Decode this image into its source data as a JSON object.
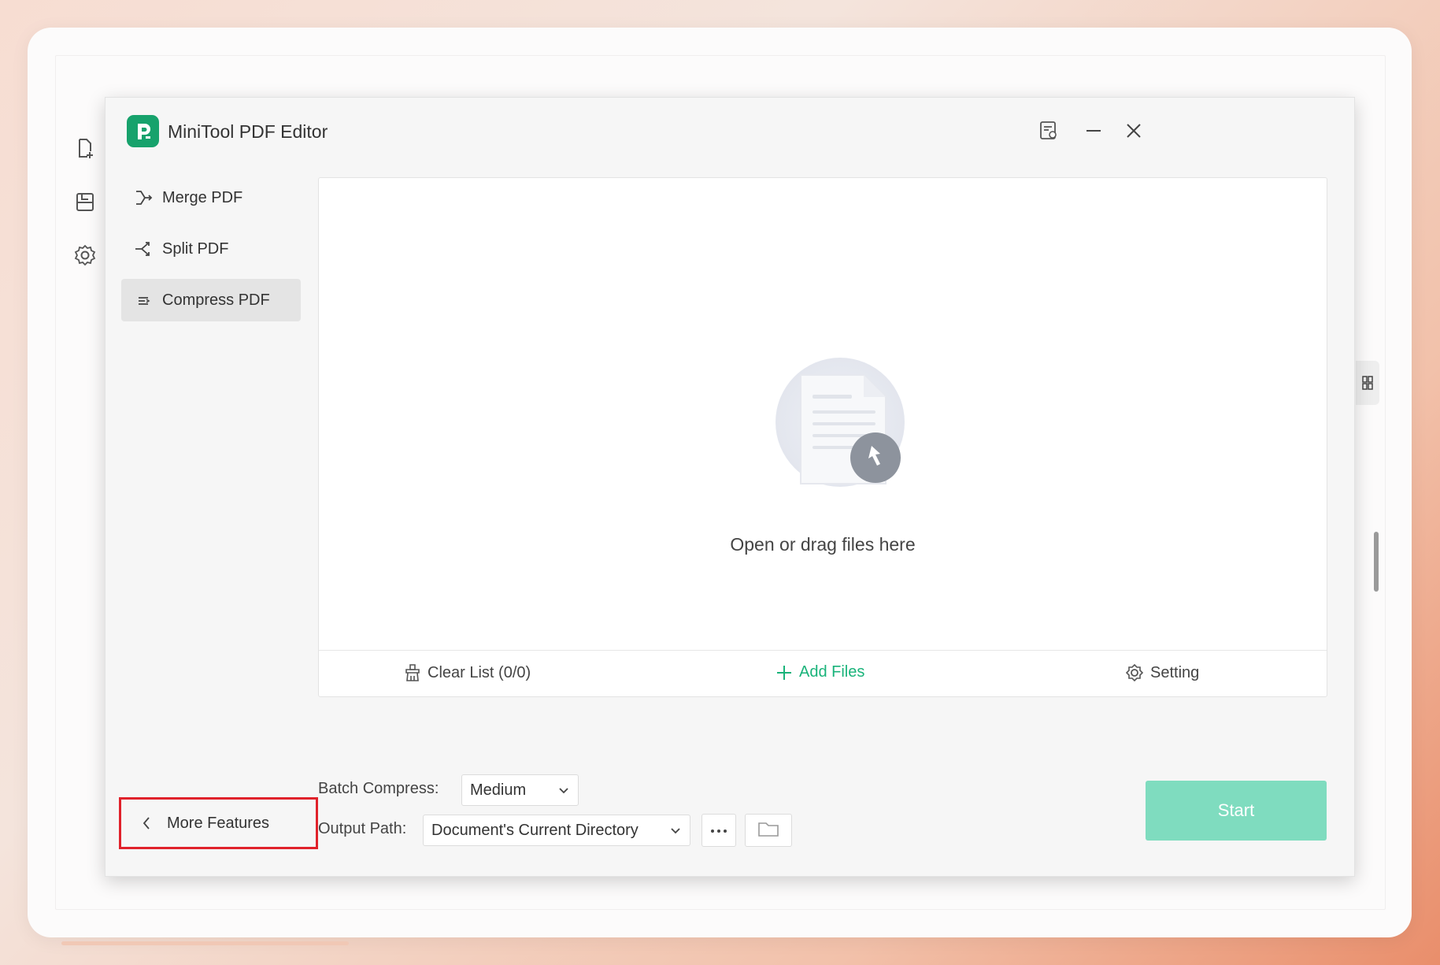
{
  "app": {
    "title": "MiniTool PDF Editor",
    "accent_color": "#17a26c"
  },
  "background_sidebar": {
    "icons": [
      "add-document-icon",
      "document-icon",
      "settings-gear-icon"
    ]
  },
  "titlebar": {
    "icons": [
      "feedback-icon",
      "minimize-icon",
      "close-icon"
    ]
  },
  "nav": {
    "items": [
      {
        "label": "Merge PDF",
        "icon": "merge-icon",
        "active": false
      },
      {
        "label": "Split PDF",
        "icon": "split-icon",
        "active": false
      },
      {
        "label": "Compress PDF",
        "icon": "compress-icon",
        "active": true
      }
    ]
  },
  "drop_area": {
    "text": "Open or drag files here"
  },
  "file_toolbar": {
    "clear_list": "Clear List (0/0)",
    "add_files": "Add Files",
    "setting": "Setting"
  },
  "options": {
    "batch_compress_label": "Batch Compress:",
    "batch_compress_value": "Medium",
    "output_path_label": "Output Path:",
    "output_path_value": "Document's Current Directory"
  },
  "actions": {
    "start": "Start",
    "start_color": "#7fdcbf",
    "more_features": "More Features"
  }
}
